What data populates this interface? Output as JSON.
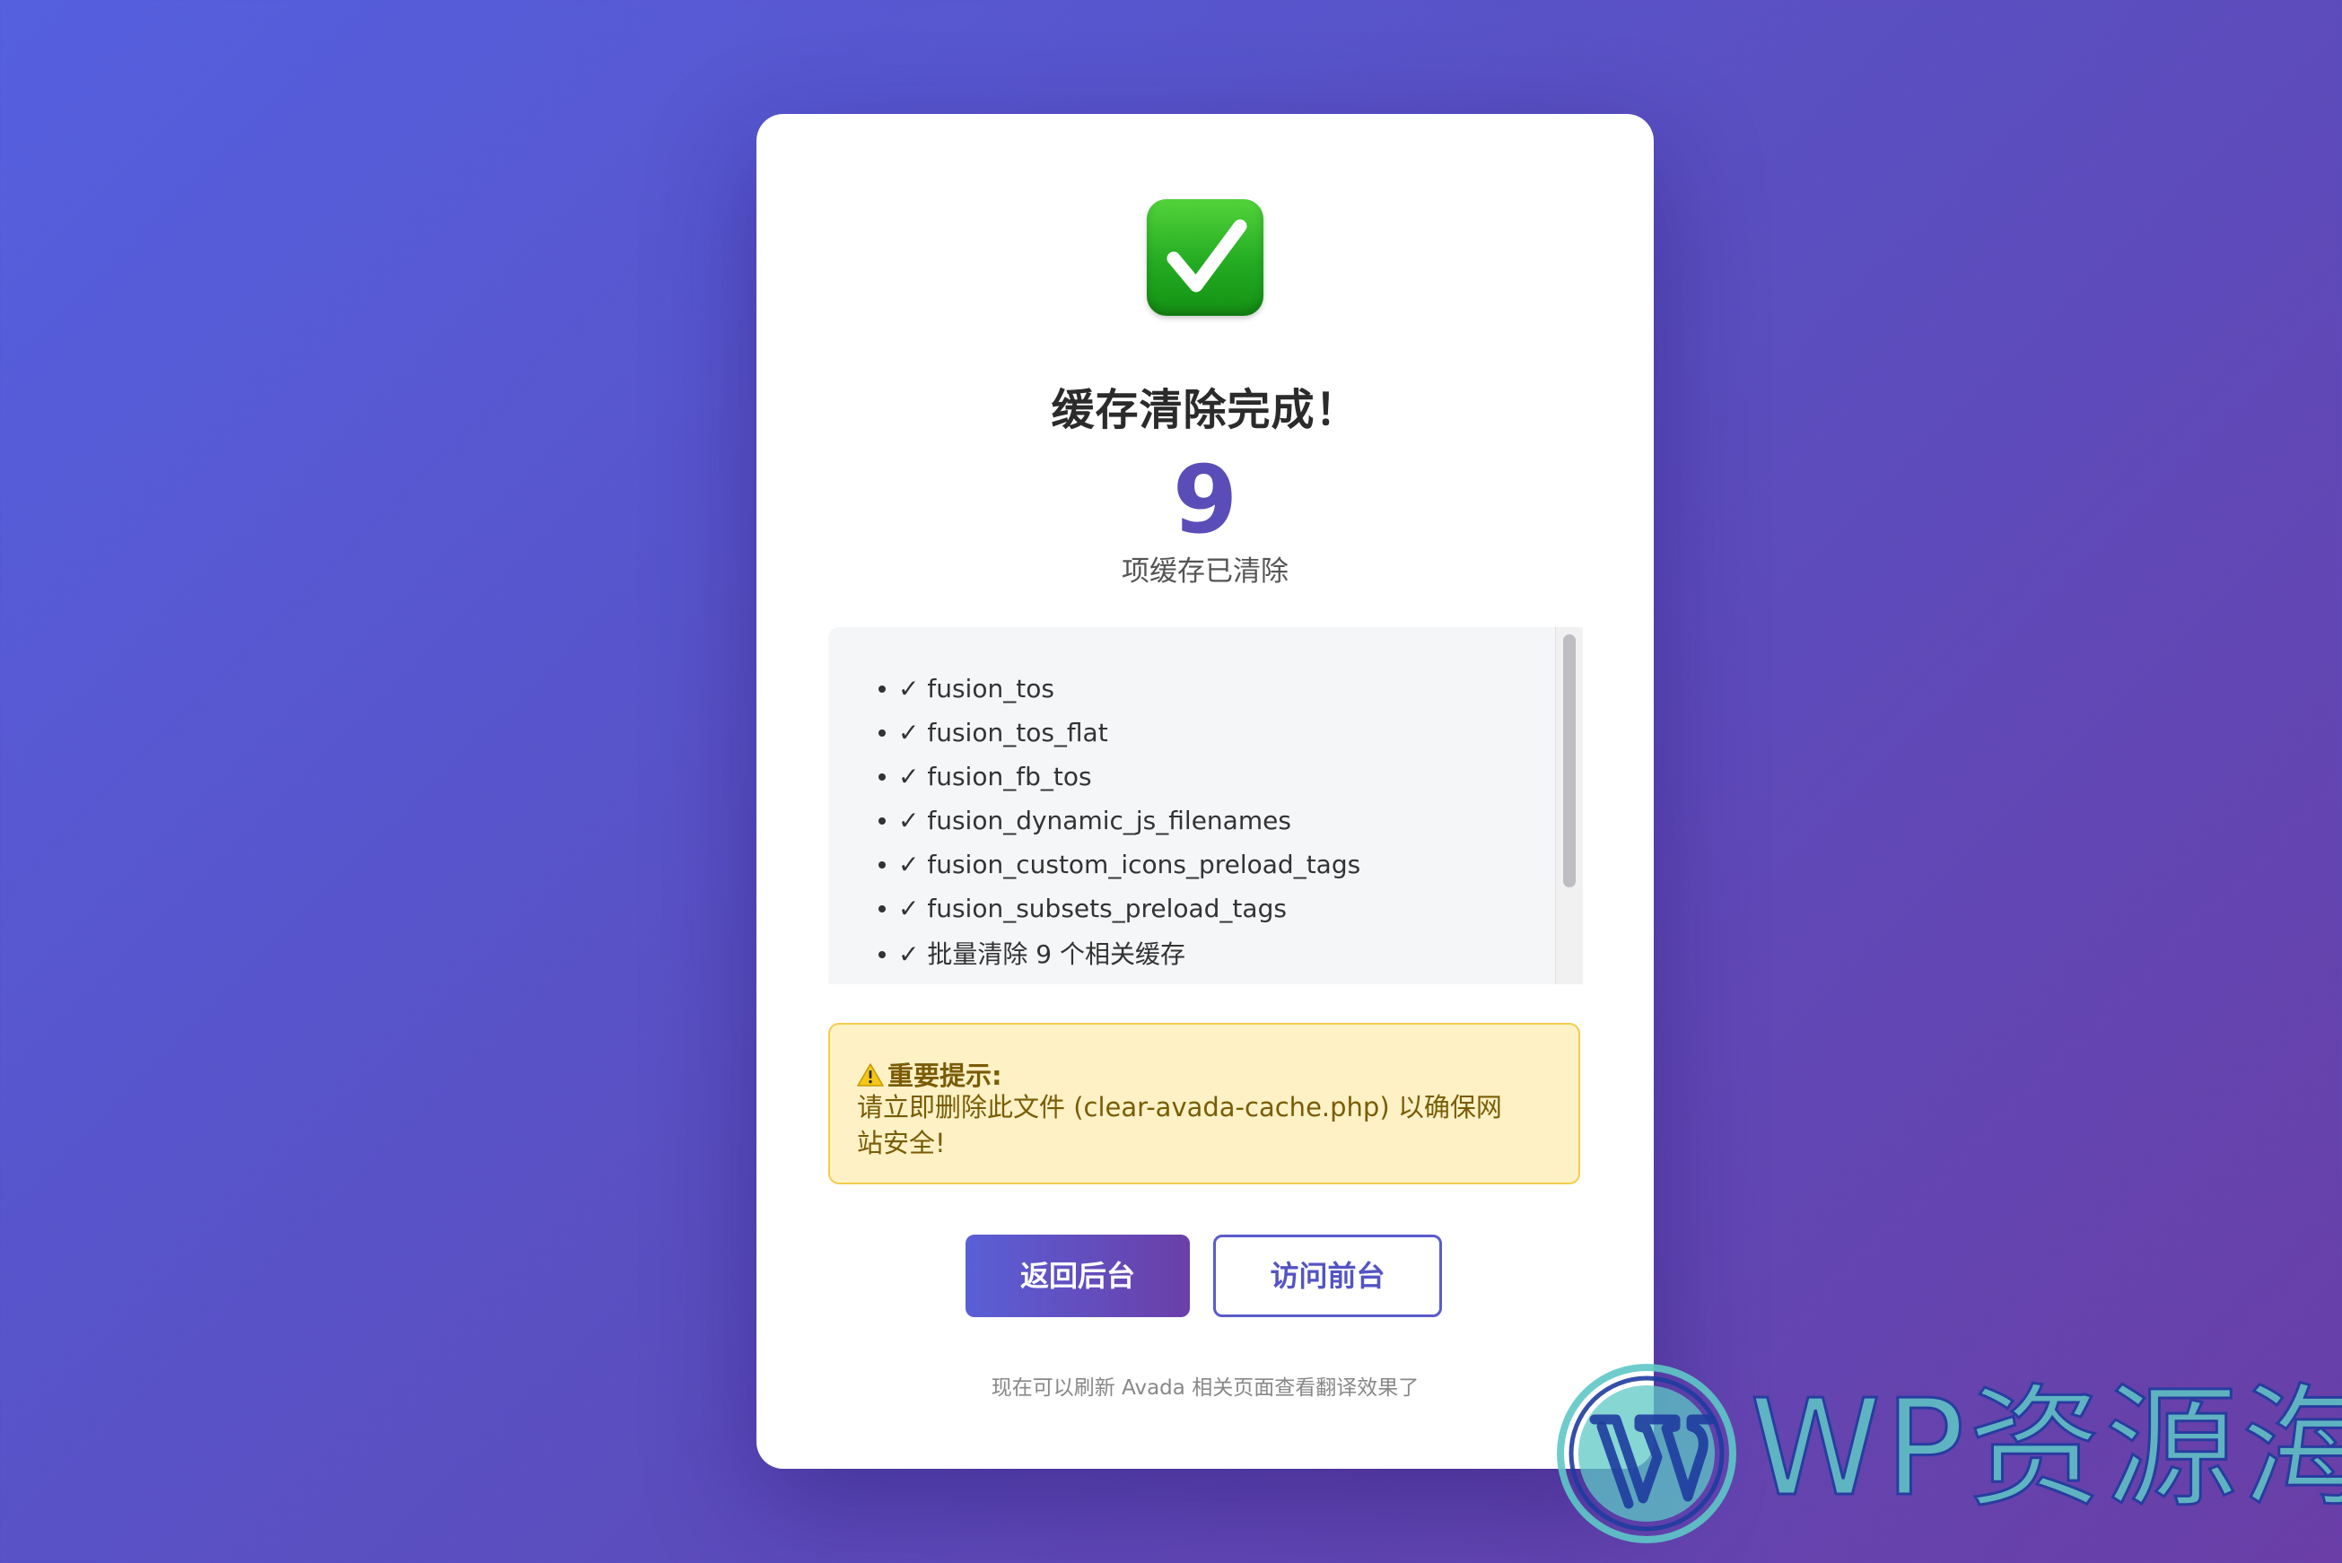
{
  "success_icon": "check-mark-button-icon",
  "title": "缓存清除完成！",
  "count": "9",
  "count_label": "项缓存已清除",
  "cleared_items": [
    "✓ fusion_tos",
    "✓ fusion_tos_flat",
    "✓ fusion_fb_tos",
    "✓ fusion_dynamic_js_filenames",
    "✓ fusion_custom_icons_preload_tags",
    "✓ fusion_subsets_preload_tags",
    "✓ 批量清除 9 个相关缓存"
  ],
  "warning": {
    "icon": "warning-icon",
    "heading": "重要提示:",
    "body": "请立即删除此文件 (clear-avada-cache.php) 以确保网站安全!"
  },
  "buttons": {
    "back_admin": "返回后台",
    "visit_frontend": "访问前台"
  },
  "footer_note": "现在可以刷新 Avada 相关页面查看翻译效果了",
  "watermark": {
    "icon": "wordpress-logo-icon",
    "text": "WP资源海"
  },
  "colors": {
    "accent": "#5b4db8",
    "primary_button_start": "#5a5fd6",
    "primary_button_end": "#6a3fa8",
    "warning_bg": "#fdf1c5",
    "warning_border": "#f2cd4b",
    "success_green": "#23ab22"
  }
}
